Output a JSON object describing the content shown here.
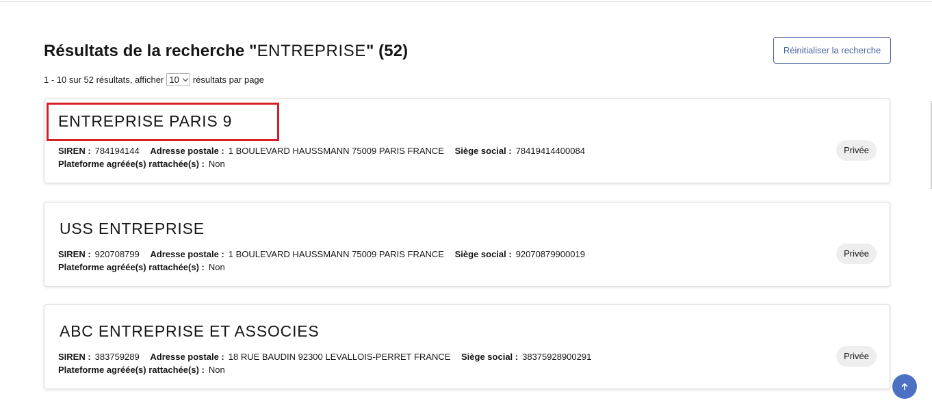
{
  "header": {
    "title_prefix": "Résultats de la recherche \"",
    "query": "ENTREPRISE",
    "title_suffix": "\" (52)",
    "reset_label": "Réinitialiser la recherche"
  },
  "pagination": {
    "range_text": "1 - 10 sur 52 résultats, afficher",
    "page_size": "10",
    "per_page_text": "résultats par page"
  },
  "labels": {
    "siren": "SIREN :",
    "address": "Adresse postale :",
    "hq": "Siège social :",
    "platform": "Plateforme agréée(s) rattachée(s) :"
  },
  "results": [
    {
      "name": "ENTREPRISE PARIS 9",
      "siren": "784194144",
      "address": "1 BOULEVARD HAUSSMANN 75009 PARIS FRANCE",
      "hq": "78419414400084",
      "platform": "Non",
      "status": "Privée"
    },
    {
      "name": "USS ENTREPRISE",
      "siren": "920708799",
      "address": "1 BOULEVARD HAUSSMANN 75009 PARIS FRANCE",
      "hq": "92070879900019",
      "platform": "Non",
      "status": "Privée"
    },
    {
      "name": "ABC ENTREPRISE ET ASSOCIES",
      "siren": "383759289",
      "address": "18 RUE BAUDIN 92300 LEVALLOIS-PERRET FRANCE",
      "hq": "38375928900291",
      "platform": "Non",
      "status": "Privée"
    }
  ],
  "colors": {
    "accent": "#465f9d",
    "highlight": "#d71f26",
    "fab": "#4c70c4",
    "badge_bg": "#eeeeee"
  },
  "icons": {
    "scroll_top": "arrow-up-icon",
    "select": "chevron-down-icon"
  }
}
